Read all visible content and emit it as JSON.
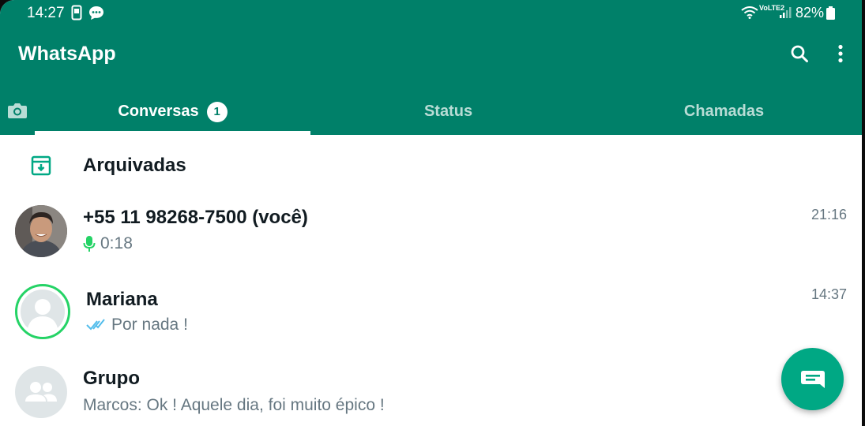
{
  "status_bar": {
    "time": "14:27",
    "network_label": "VoLTE2",
    "battery": "82%"
  },
  "header": {
    "title": "WhatsApp",
    "search_icon": "search-icon",
    "menu_icon": "more-vert-icon"
  },
  "tabs": [
    {
      "label": "Conversas",
      "badge": "1",
      "active": true
    },
    {
      "label": "Status",
      "active": false
    },
    {
      "label": "Chamadas",
      "active": false
    }
  ],
  "archived": {
    "label": "Arquivadas",
    "icon": "archive-icon"
  },
  "chats": [
    {
      "name": "+55 11 98268-7500 (você)",
      "preview": "0:18",
      "preview_icon": "mic-icon",
      "time": "21:16"
    },
    {
      "name": "Mariana",
      "preview": "Por nada !",
      "preview_icon": "double-check-icon",
      "time": "14:37"
    },
    {
      "name": "Grupo",
      "preview": "Marcos: Ok ! Aquele dia, foi muito épico !",
      "time": ""
    }
  ],
  "fab": {
    "icon": "new-chat-icon"
  },
  "colors": {
    "header": "#008069",
    "accent": "#00a884",
    "text_primary": "#111b21",
    "text_secondary": "#667781",
    "status_ring": "#25d366"
  }
}
